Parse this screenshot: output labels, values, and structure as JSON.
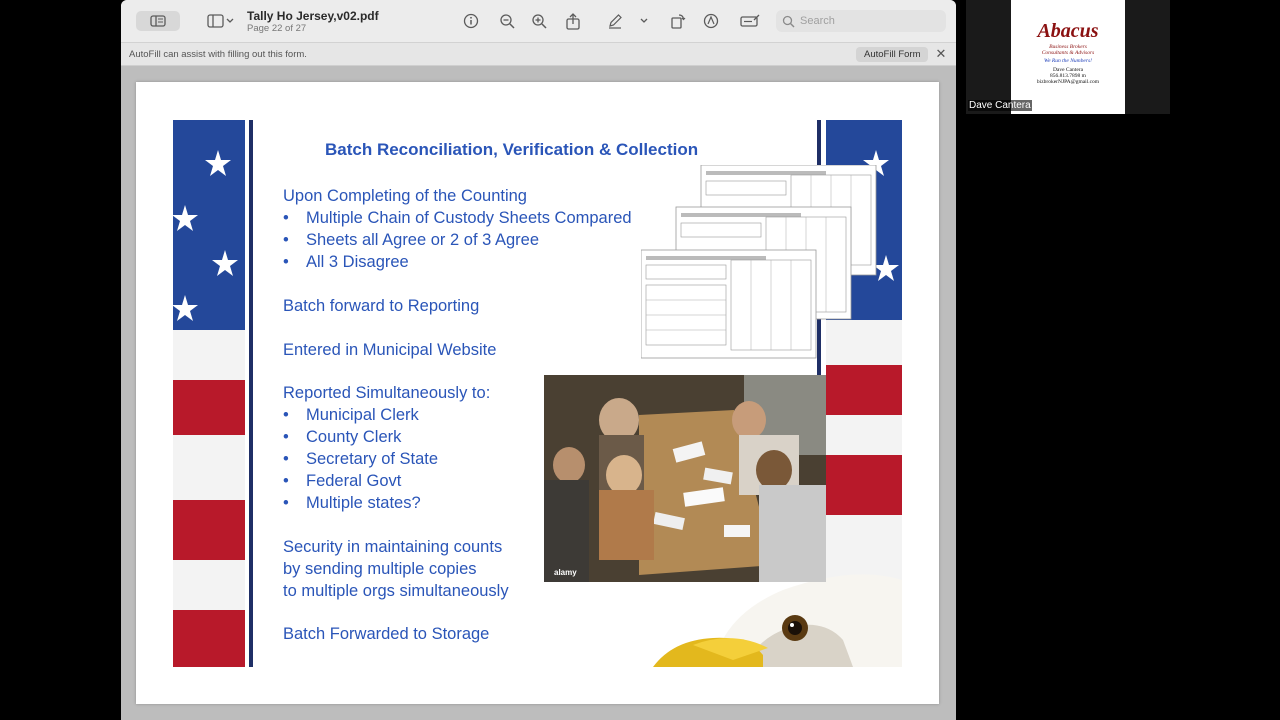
{
  "window": {
    "title": "Tally Ho Jersey,v02.pdf",
    "page_info": "Page 22 of 27",
    "search_placeholder": "Search",
    "toolbar_icons": [
      "sidebar-icon",
      "info-icon",
      "zoom-out-icon",
      "zoom-in-icon",
      "share-icon",
      "markup-pen-icon",
      "rotate-icon",
      "annotate-icon",
      "form-icon",
      "search-icon"
    ]
  },
  "autofill": {
    "message": "AutoFill can assist with filling out this form.",
    "button": "AutoFill Form",
    "close": "✕"
  },
  "slide": {
    "title": "Batch Reconciliation, Verification & Collection",
    "section1": "Upon Completing of the Counting",
    "bullets1": [
      "Multiple Chain of Custody Sheets Compared",
      "Sheets all Agree or 2 of 3 Agree",
      "All 3 Disagree"
    ],
    "line_batch_forward": "Batch forward to Reporting",
    "line_entered": "Entered in Municipal Website",
    "section2": "Reported Simultaneously to:",
    "bullets2": [
      "Municipal Clerk",
      "County Clerk",
      "Secretary of State",
      "Federal Govt",
      "Multiple states?"
    ],
    "security_lines": [
      "Security in maintaining counts",
      "by sending multiple copies",
      "to multiple orgs simultaneously"
    ],
    "line_storage": "Batch Forwarded to Storage",
    "bullet_char": "•",
    "photo_caption": "alamy"
  },
  "participant": {
    "name": "Dave Cantera",
    "logo_title": "Abacus",
    "logo_sub1": "Business Brokers",
    "logo_sub2": "Consultants & Advisors",
    "logo_tagline": "We Run the Numbers!",
    "logo_contact_name": "Dave Cantera",
    "logo_phone": "856.813.7898 m",
    "logo_email": "bizbrokerNJPA@gmail.com"
  },
  "colors": {
    "slide_text": "#2a55b8",
    "flag_red": "#b8192a",
    "flag_blue": "#1f3f8f",
    "logo_red": "#8b1111"
  }
}
